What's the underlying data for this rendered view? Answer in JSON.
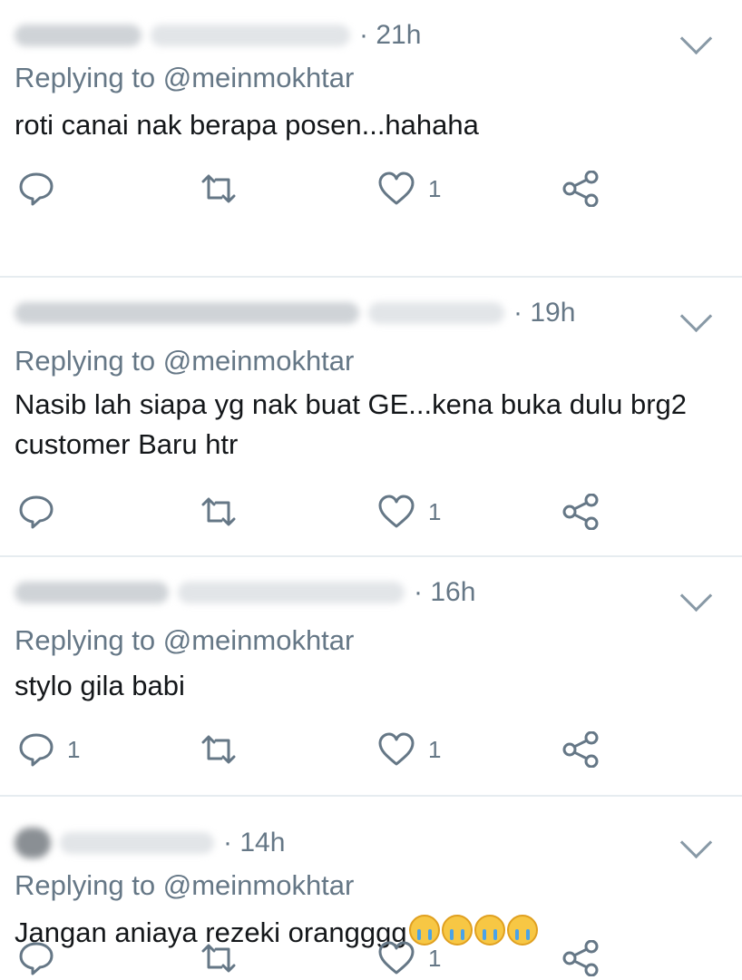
{
  "replies": [
    {
      "time": "· 21h",
      "replying_prefix": "Replying to ",
      "handle": "@meinmokhtar",
      "text": "roti canai nak berapa posen...hahaha",
      "reply_count": "",
      "like_count": "1"
    },
    {
      "time": "· 19h",
      "replying_prefix": "Replying to ",
      "handle": "@meinmokhtar",
      "text_line1": "Nasib lah siapa yg nak buat GE...kena buka dulu brg2",
      "text_line2": "customer Baru htr",
      "reply_count": "",
      "like_count": "1"
    },
    {
      "time": "· 16h",
      "replying_prefix": "Replying to ",
      "handle": "@meinmokhtar",
      "text": "stylo gila babi",
      "reply_count": "1",
      "like_count": "1"
    },
    {
      "time": "· 14h",
      "replying_prefix": "Replying to ",
      "handle": "@meinmokhtar",
      "text": "Jangan aniaya rezeki orangggg",
      "emoji": "crying-face x4",
      "reply_count": "",
      "like_count": "1"
    }
  ],
  "icons": [
    "reply-icon",
    "retweet-icon",
    "heart-icon",
    "share-icon",
    "chevron-down-icon"
  ],
  "colors": {
    "text": "#14171a",
    "muted": "#657786",
    "icon": "#657786",
    "divider": "#e6ecf0"
  }
}
